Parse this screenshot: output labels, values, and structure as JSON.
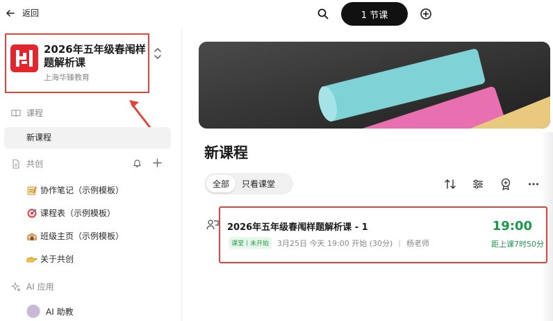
{
  "topbar": {
    "back_label": "返回",
    "lesson_count_label": "1 节课"
  },
  "course": {
    "title": "2026年五年级春闱样题解析课",
    "org": "上海华臻教育",
    "brand_color": "#e3262e"
  },
  "sidebar": {
    "courses_header": "课程",
    "active_item": "新课程",
    "cocreate_header": "共创",
    "cocreate_items": [
      {
        "label": "协作笔记（示例模板）",
        "icon": "memo-icon"
      },
      {
        "label": "课程表（示例模板）",
        "icon": "target-icon"
      },
      {
        "label": "班级主页（示例模板）",
        "icon": "school-icon"
      },
      {
        "label": "关于共创",
        "icon": "pointing-hand-icon"
      }
    ],
    "ai_header": "AI 应用",
    "ai_item": "AI 助教"
  },
  "main": {
    "page_title": "新课程",
    "filter_all": "全部",
    "filter_lessons": "只看课堂",
    "lesson": {
      "title": "2026年五年级春闱样题解析课 - 1",
      "badge": "课堂丨未开始",
      "schedule": "3月25日 今天 19:00 开始 (30分)",
      "teacher": "杨老师",
      "time": "19:00",
      "countdown": "距上课7时50分"
    }
  },
  "colors": {
    "accent_green": "#1a9a47",
    "highlight_red": "#e0453c"
  }
}
